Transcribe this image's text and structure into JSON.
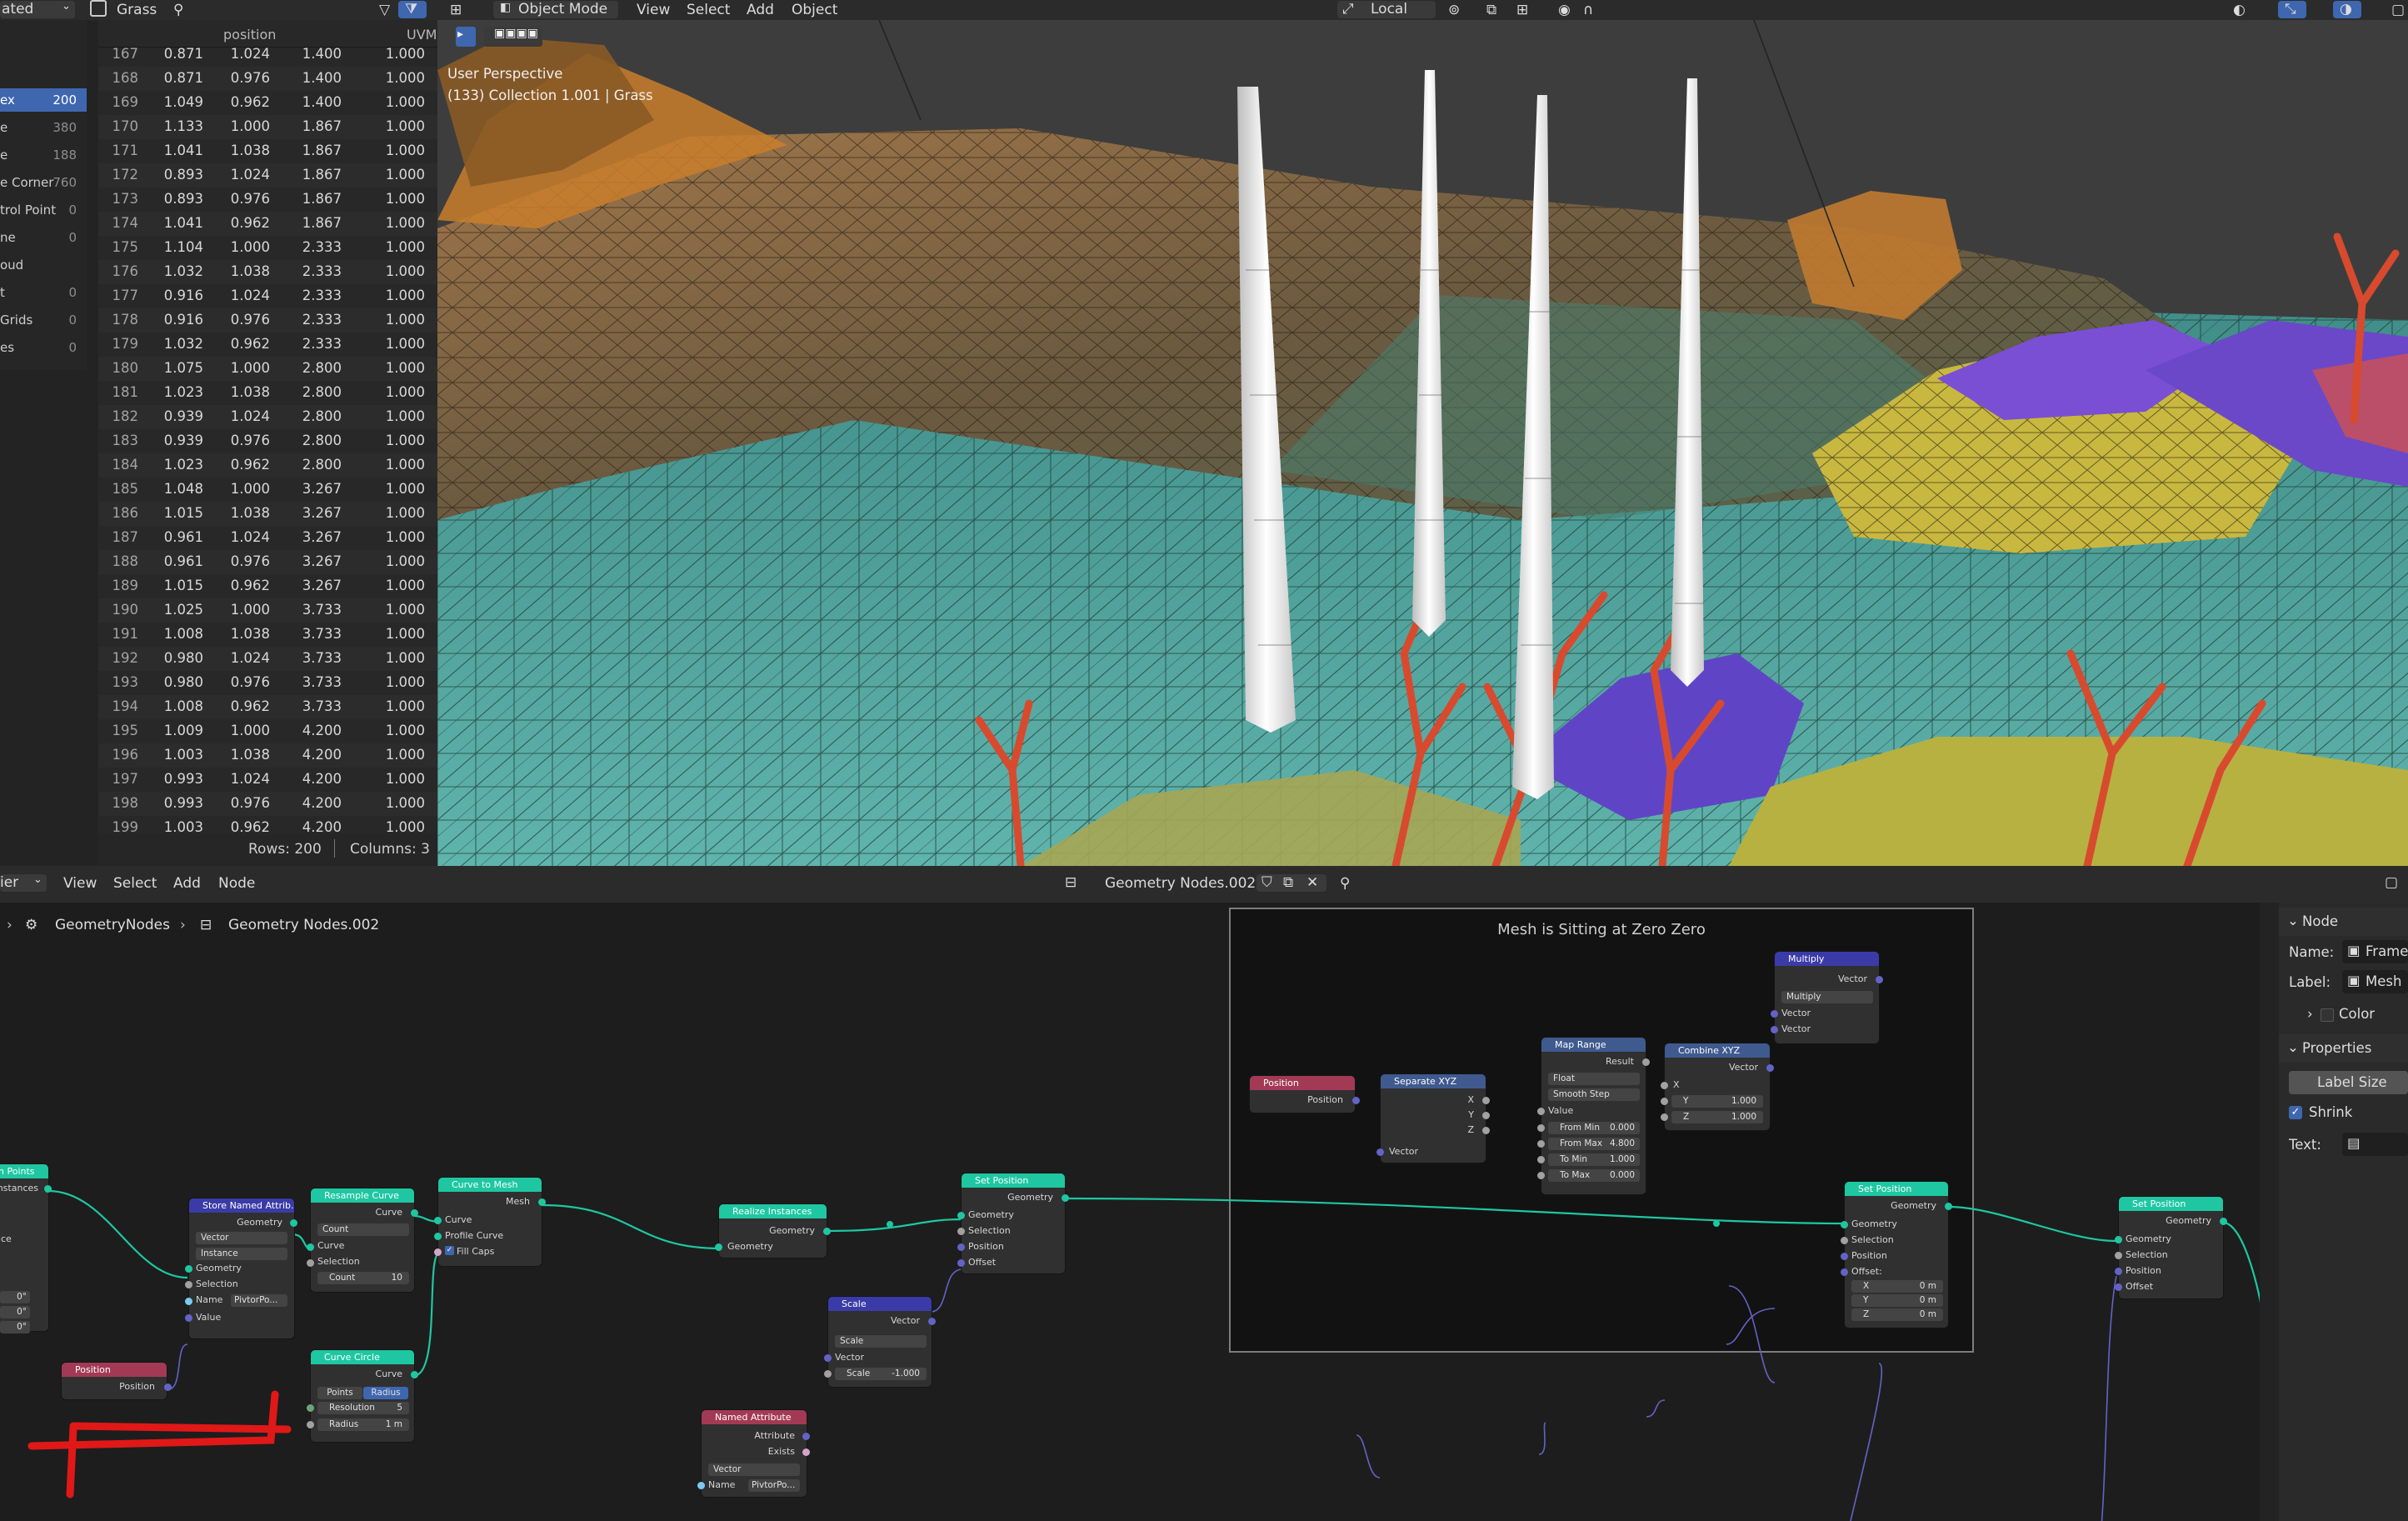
{
  "top_header": {
    "left_dropdown": "ated",
    "object_name": "Grass",
    "mode": "Object Mode",
    "menu": [
      "View",
      "Select",
      "Add",
      "Object"
    ],
    "transform_orientation": "Local"
  },
  "spreadsheet": {
    "domains": [
      {
        "label": "ex",
        "count": "200",
        "selected": true
      },
      {
        "label": "e",
        "count": "380"
      },
      {
        "label": "e",
        "count": "188"
      },
      {
        "label": "e Corner",
        "count": "760"
      },
      {
        "label": "trol Point",
        "count": "0"
      },
      {
        "label": "ne",
        "count": "0"
      },
      {
        "label": "oud",
        "count": ""
      },
      {
        "label": "t",
        "count": "0"
      },
      {
        "label": "Grids",
        "count": "0"
      },
      {
        "label": "es",
        "count": "0"
      }
    ],
    "columns": [
      "position",
      "UVM"
    ],
    "rows": [
      [
        "167",
        "0.871",
        "1.024",
        "1.400",
        "1.000"
      ],
      [
        "168",
        "0.871",
        "0.976",
        "1.400",
        "1.000"
      ],
      [
        "169",
        "1.049",
        "0.962",
        "1.400",
        "1.000"
      ],
      [
        "170",
        "1.133",
        "1.000",
        "1.867",
        "1.000"
      ],
      [
        "171",
        "1.041",
        "1.038",
        "1.867",
        "1.000"
      ],
      [
        "172",
        "0.893",
        "1.024",
        "1.867",
        "1.000"
      ],
      [
        "173",
        "0.893",
        "0.976",
        "1.867",
        "1.000"
      ],
      [
        "174",
        "1.041",
        "0.962",
        "1.867",
        "1.000"
      ],
      [
        "175",
        "1.104",
        "1.000",
        "2.333",
        "1.000"
      ],
      [
        "176",
        "1.032",
        "1.038",
        "2.333",
        "1.000"
      ],
      [
        "177",
        "0.916",
        "1.024",
        "2.333",
        "1.000"
      ],
      [
        "178",
        "0.916",
        "0.976",
        "2.333",
        "1.000"
      ],
      [
        "179",
        "1.032",
        "0.962",
        "2.333",
        "1.000"
      ],
      [
        "180",
        "1.075",
        "1.000",
        "2.800",
        "1.000"
      ],
      [
        "181",
        "1.023",
        "1.038",
        "2.800",
        "1.000"
      ],
      [
        "182",
        "0.939",
        "1.024",
        "2.800",
        "1.000"
      ],
      [
        "183",
        "0.939",
        "0.976",
        "2.800",
        "1.000"
      ],
      [
        "184",
        "1.023",
        "0.962",
        "2.800",
        "1.000"
      ],
      [
        "185",
        "1.048",
        "1.000",
        "3.267",
        "1.000"
      ],
      [
        "186",
        "1.015",
        "1.038",
        "3.267",
        "1.000"
      ],
      [
        "187",
        "0.961",
        "1.024",
        "3.267",
        "1.000"
      ],
      [
        "188",
        "0.961",
        "0.976",
        "3.267",
        "1.000"
      ],
      [
        "189",
        "1.015",
        "0.962",
        "3.267",
        "1.000"
      ],
      [
        "190",
        "1.025",
        "1.000",
        "3.733",
        "1.000"
      ],
      [
        "191",
        "1.008",
        "1.038",
        "3.733",
        "1.000"
      ],
      [
        "192",
        "0.980",
        "1.024",
        "3.733",
        "1.000"
      ],
      [
        "193",
        "0.980",
        "0.976",
        "3.733",
        "1.000"
      ],
      [
        "194",
        "1.008",
        "0.962",
        "3.733",
        "1.000"
      ],
      [
        "195",
        "1.009",
        "1.000",
        "4.200",
        "1.000"
      ],
      [
        "196",
        "1.003",
        "1.038",
        "4.200",
        "1.000"
      ],
      [
        "197",
        "0.993",
        "1.024",
        "4.200",
        "1.000"
      ],
      [
        "198",
        "0.993",
        "0.976",
        "4.200",
        "1.000"
      ],
      [
        "199",
        "1.003",
        "0.962",
        "4.200",
        "1.000"
      ]
    ],
    "rows_label": "Rows: 200",
    "columns_label": "Columns: 3"
  },
  "viewport": {
    "perspective": "User Perspective",
    "collection": "(133) Collection 1.001 | Grass"
  },
  "node_editor": {
    "editor_type": "ier",
    "menu": [
      "View",
      "Select",
      "Add",
      "Node"
    ],
    "tree_name": "Geometry Nodes.002",
    "breadcrumb": [
      "GeometryNodes",
      "Geometry Nodes.002"
    ],
    "frame_label": "Mesh is Sitting at Zero Zero",
    "nodes": {
      "points": {
        "title": "n Points",
        "out": "Instances",
        "in_a": "nce",
        "in_b": "x",
        "f1": "0°",
        "f2": "0°",
        "f3": "0°"
      },
      "store": {
        "title": "Store Named Attrib...",
        "out": "Geometry",
        "dt": "Vector",
        "domain": "Instance",
        "in1": "Geometry",
        "in2": "Selection",
        "name_lbl": "Name",
        "name_val": "PivtorPo...",
        "in4": "Value"
      },
      "pos1": {
        "title": "Position",
        "out": "Position"
      },
      "resample": {
        "title": "Resample Curve",
        "out": "Curve",
        "mode": "Count",
        "in1": "Curve",
        "in2": "Selection",
        "count_lbl": "Count",
        "count_val": "10"
      },
      "circle": {
        "title": "Curve Circle",
        "out": "Curve",
        "tab1": "Points",
        "tab2": "Radius",
        "res_lbl": "Resolution",
        "res_val": "5",
        "rad_lbl": "Radius",
        "rad_val": "1 m"
      },
      "c2m": {
        "title": "Curve to Mesh",
        "out": "Mesh",
        "in1": "Curve",
        "in2": "Profile Curve",
        "fill": "Fill Caps"
      },
      "realize": {
        "title": "Realize Instances",
        "out": "Geometry",
        "in1": "Geometry"
      },
      "scale": {
        "title": "Scale",
        "out": "Vector",
        "op": "Scale",
        "in1": "Vector",
        "sc_lbl": "Scale",
        "sc_val": "-1.000"
      },
      "named": {
        "title": "Named Attribute",
        "out1": "Attribute",
        "out2": "Exists",
        "dt": "Vector",
        "name_lbl": "Name",
        "name_val": "PivtorPo..."
      },
      "setpos1": {
        "title": "Set Position",
        "out": "Geometry",
        "in1": "Geometry",
        "in2": "Selection",
        "in3": "Position",
        "in4": "Offset"
      },
      "pos2": {
        "title": "Position",
        "out": "Position"
      },
      "sep": {
        "title": "Separate XYZ",
        "o1": "X",
        "o2": "Y",
        "o3": "Z",
        "in1": "Vector"
      },
      "maprange": {
        "title": "Map Range",
        "out": "Result",
        "dt": "Float",
        "interp": "Smooth Step",
        "in1": "Value",
        "f1l": "From Min",
        "f1v": "0.000",
        "f2l": "From Max",
        "f2v": "4.800",
        "f3l": "To Min",
        "f3v": "1.000",
        "f4l": "To Max",
        "f4v": "0.000"
      },
      "combine": {
        "title": "Combine XYZ",
        "out": "Vector",
        "x": "X",
        "yl": "Y",
        "yv": "1.000",
        "zl": "Z",
        "zv": "1.000"
      },
      "pos3": {
        "title": "Position",
        "out": "Position"
      },
      "multiply": {
        "title": "Multiply",
        "out": "Vector",
        "op": "Multiply",
        "in1": "Vector",
        "in2": "Vector"
      },
      "setpos2": {
        "title": "Set Position",
        "out": "Geometry",
        "in1": "Geometry",
        "in2": "Selection",
        "in3": "Position",
        "in4": "Offset:",
        "xl": "X",
        "xv": "0 m",
        "yl": "Y",
        "yv": "0 m",
        "zl": "Z",
        "zv": "0 m"
      },
      "setpos3": {
        "title": "Set Position",
        "out": "Geometry",
        "in1": "Geometry",
        "in2": "Selection",
        "in3": "Position",
        "in4": "Offset"
      }
    }
  },
  "properties": {
    "node_section": "Node",
    "name_label": "Name:",
    "name_value": "Frame",
    "label_label": "Label:",
    "label_value": "Mesh",
    "color_label": "Color",
    "properties_section": "Properties",
    "label_size": "Label Size",
    "shrink": "Shrink",
    "text_label": "Text:"
  },
  "colors": {
    "geometry_socket": "#1ec7a1",
    "vector_socket": "#6363c7",
    "selection_highlight": "#3f67b0",
    "annotation_red": "#e01818"
  }
}
